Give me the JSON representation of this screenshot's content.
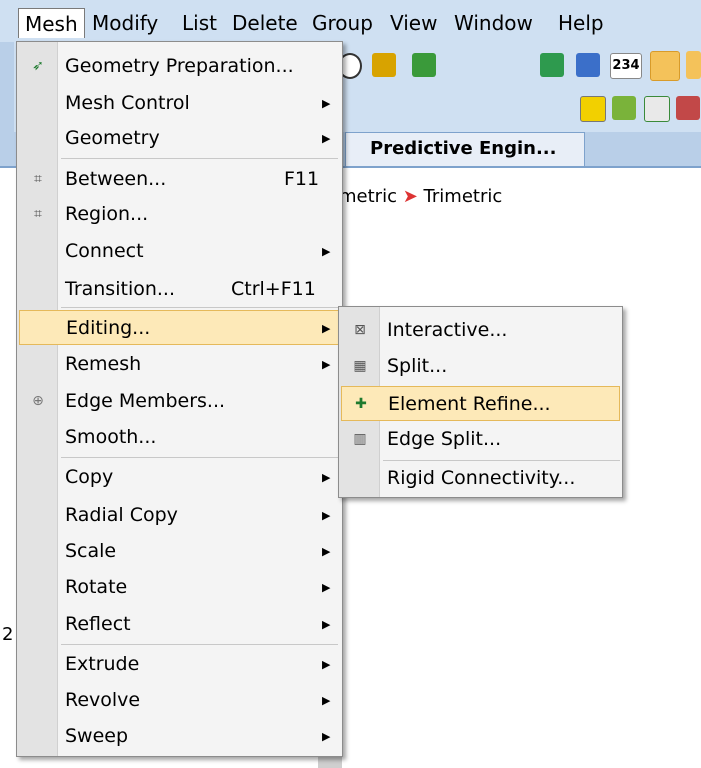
{
  "menubar": {
    "items": [
      "Mesh",
      "Modify",
      "List",
      "Delete",
      "Group",
      "View",
      "Window",
      "Help"
    ]
  },
  "toolbar": {
    "view_metric": "metric",
    "view_trimetric": "Trimetric",
    "badge_234": "234"
  },
  "tabs": {
    "active": "Predictive Engin..."
  },
  "side_digit": "2",
  "mesh_menu": {
    "items": [
      {
        "label": "Geometry Preparation...",
        "icon": "geometry-prep-icon"
      },
      {
        "label": "Mesh Control",
        "submenu": true
      },
      {
        "label": "Geometry",
        "submenu": true
      },
      {
        "label": "Between...",
        "shortcut": "F11",
        "icon": "between-grid-icon"
      },
      {
        "label": "Region...",
        "icon": "region-grid-icon"
      },
      {
        "label": "Connect",
        "submenu": true
      },
      {
        "label": "Transition...",
        "shortcut": "Ctrl+F11"
      },
      {
        "label": "Editing...",
        "submenu": true
      },
      {
        "label": "Remesh",
        "submenu": true
      },
      {
        "label": "Edge Members...",
        "icon": "edge-members-icon"
      },
      {
        "label": "Smooth..."
      },
      {
        "label": "Copy",
        "submenu": true
      },
      {
        "label": "Radial Copy",
        "submenu": true
      },
      {
        "label": "Scale",
        "submenu": true
      },
      {
        "label": "Rotate",
        "submenu": true
      },
      {
        "label": "Reflect",
        "submenu": true
      },
      {
        "label": "Extrude",
        "submenu": true
      },
      {
        "label": "Revolve",
        "submenu": true
      },
      {
        "label": "Sweep",
        "submenu": true
      }
    ]
  },
  "editing_submenu": {
    "items": [
      {
        "label": "Interactive...",
        "icon": "interactive-icon"
      },
      {
        "label": "Split...",
        "icon": "split-grid-icon"
      },
      {
        "label": "Element Refine...",
        "icon": "element-refine-icon"
      },
      {
        "label": "Edge Split...",
        "icon": "edge-split-icon"
      },
      {
        "label": "Rigid Connectivity..."
      }
    ]
  },
  "colors": {
    "menu_highlight": "#fde9b8",
    "menu_highlight_border": "#e5b95a",
    "menubar_bg": "#cfe0f2"
  }
}
